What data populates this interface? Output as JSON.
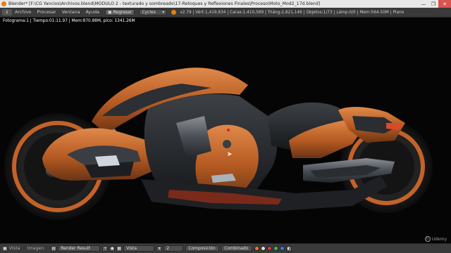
{
  "window": {
    "title": "Blender* [F:\\CG Yancios\\Archivos.blend\\MODULO 2 - texturado y sombreado\\17-Retoques y Reflexiones Finales\\Proceso\\Moto_Mod2_17d.blend]",
    "controls": [
      "—",
      "❐",
      "✕"
    ]
  },
  "menu": {
    "items": [
      "Archivo",
      "Procesar",
      "Ventana",
      "Ayuda"
    ],
    "back_button": "Regresar",
    "engine": "Cycles",
    "stats": "v2.79 | Vért:1,419,834 | Caras:1,410,589 | Triáng:2,821,146 | Objetos:1/73 | Lámp:0/0 | Mem:564.50M | Plano"
  },
  "viewport": {
    "frame_info": "Fotograma:1 | Tiempo:01:11.97 | Mem:870.88M, pico: 1341.26M",
    "watermark": "Udemy"
  },
  "bottom": {
    "view_menu": "Vista",
    "image_menu": "Imagen",
    "image_name": "Render Result",
    "slot_label": "Vista",
    "slot_number": "2",
    "pass_label": "Composición",
    "combined_label": "Combinado"
  },
  "colors": {
    "accent": "#e87d0d",
    "header_bg": "#3a3a3a",
    "body_paint": "#c8652a"
  }
}
